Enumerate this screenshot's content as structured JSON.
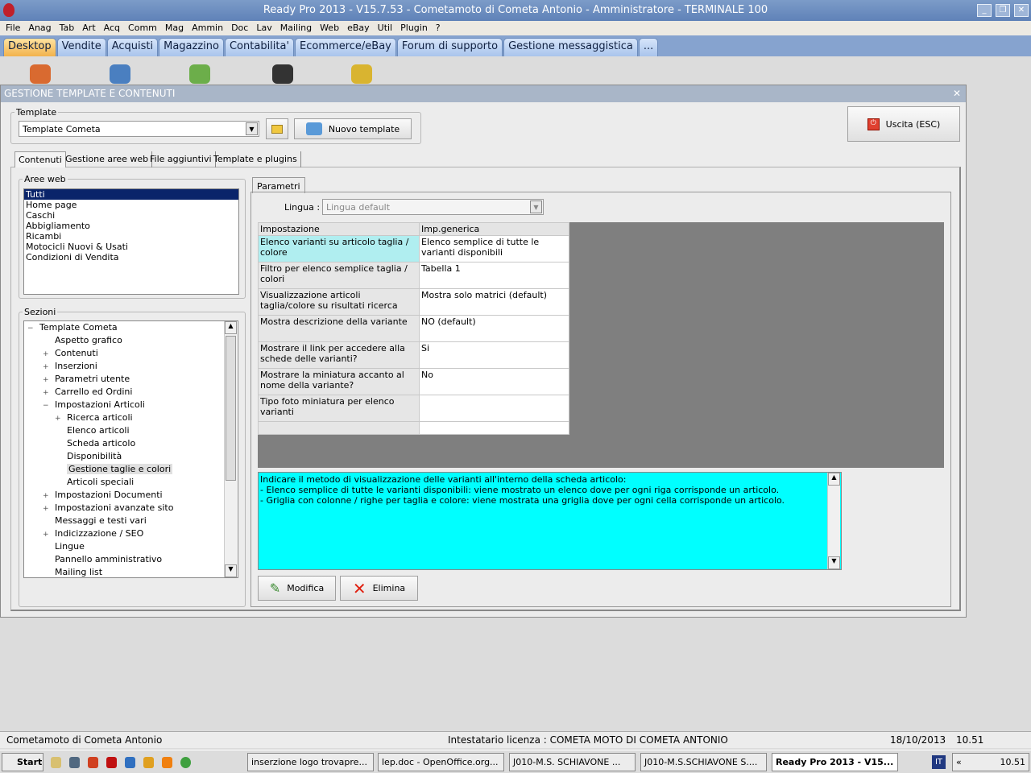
{
  "title": "Ready Pro 2013 - V15.7.53 - Cometamoto di Cometa Antonio - Amministratore - TERMINALE 100",
  "menu": [
    "File",
    "Anag",
    "Tab",
    "Art",
    "Acq",
    "Comm",
    "Mag",
    "Ammin",
    "Doc",
    "Lav",
    "Mailing",
    "Web",
    "eBay",
    "Util",
    "Plugin",
    "?"
  ],
  "main_tabs": [
    "Desktop",
    "Vendite",
    "Acquisti",
    "Magazzino",
    "Contabilita'",
    "Ecommerce/eBay",
    "Forum di supporto",
    "Gestione messaggistica",
    "..."
  ],
  "window": {
    "title": "GESTIONE TEMPLATE E CONTENUTI",
    "template_label": "Template",
    "template_value": "Template Cometa",
    "new_template": "Nuovo template",
    "exit": "Uscita (ESC)",
    "sub_tabs": [
      "Contenuti",
      "Gestione aree web",
      "File aggiuntivi",
      "Template e plugins"
    ],
    "aree_label": "Aree web",
    "aree": [
      "Tutti",
      "Home page",
      "Caschi",
      "Abbigliamento",
      "Ricambi",
      "Motocicli Nuovi & Usati",
      "Condizioni di Vendita"
    ],
    "sezioni_label": "Sezioni",
    "tree": [
      {
        "t": "Template Cometa",
        "l": 0,
        "s": "−"
      },
      {
        "t": "Aspetto grafico",
        "l": 1,
        "s": ""
      },
      {
        "t": "Contenuti",
        "l": 1,
        "s": "+"
      },
      {
        "t": "Inserzioni",
        "l": 1,
        "s": "+"
      },
      {
        "t": "Parametri utente",
        "l": 1,
        "s": "+"
      },
      {
        "t": "Carrello ed Ordini",
        "l": 1,
        "s": "+"
      },
      {
        "t": "Impostazioni Articoli",
        "l": 1,
        "s": "−"
      },
      {
        "t": "Ricerca articoli",
        "l": 2,
        "s": "+"
      },
      {
        "t": "Elenco articoli",
        "l": 2,
        "s": ""
      },
      {
        "t": "Scheda articolo",
        "l": 2,
        "s": ""
      },
      {
        "t": "Disponibilità",
        "l": 2,
        "s": ""
      },
      {
        "t": "Gestione taglie e colori",
        "l": 2,
        "s": "",
        "sel": true
      },
      {
        "t": "Articoli speciali",
        "l": 2,
        "s": ""
      },
      {
        "t": "Impostazioni Documenti",
        "l": 1,
        "s": "+"
      },
      {
        "t": "Impostazioni avanzate sito",
        "l": 1,
        "s": "+"
      },
      {
        "t": "Messaggi e testi vari",
        "l": 1,
        "s": ""
      },
      {
        "t": "Indicizzazione / SEO",
        "l": 1,
        "s": "+"
      },
      {
        "t": "Lingue",
        "l": 1,
        "s": ""
      },
      {
        "t": "Pannello amministrativo",
        "l": 1,
        "s": ""
      },
      {
        "t": "Mailing list",
        "l": 1,
        "s": ""
      }
    ],
    "param_tab": "Parametri",
    "lingua_label": "Lingua :",
    "lingua_value": "Lingua default",
    "grid_headers": [
      "Impostazione",
      "Imp.generica"
    ],
    "grid_rows": [
      [
        "Elenco varianti su articolo taglia / colore",
        "Elenco semplice di tutte le varianti disponibili"
      ],
      [
        "Filtro per elenco semplice taglia / colori",
        "Tabella 1"
      ],
      [
        "Visualizzazione articoli taglia/colore su risultati ricerca",
        "Mostra solo matrici (default)"
      ],
      [
        "Mostra descrizione della variante",
        "NO (default)"
      ],
      [
        "Mostrare il link per accedere alla schede delle varianti?",
        "Si"
      ],
      [
        "Mostrare la miniatura accanto al nome della variante?",
        "No"
      ],
      [
        "Tipo foto miniatura per elenco varianti",
        ""
      ],
      [
        "",
        ""
      ]
    ],
    "description": [
      "Indicare il metodo di visualizzazione delle varianti all'interno della scheda articolo:",
      "- Elenco semplice di tutte le varianti disponibili: viene mostrato un elenco dove per ogni riga corrisponde un articolo.",
      "- Griglia con colonne / righe per taglia e colore: viene mostrata una griglia dove per ogni cella corrisponde un articolo."
    ],
    "modifica": "Modifica",
    "elimina": "Elimina"
  },
  "status": {
    "company": "Cometamoto di Cometa Antonio",
    "license": "Intestatario licenza : COMETA MOTO DI COMETA ANTONIO",
    "date": "18/10/2013",
    "time": "10.51"
  },
  "taskbar": {
    "start": "Start",
    "tasks": [
      "inserzione logo trovapre...",
      "lep.doc - OpenOffice.org...",
      "J010-M.S. SCHIAVONE ...",
      "J010-M.S.SCHIAVONE S....",
      "Ready Pro 2013 - V15..."
    ],
    "lang": "IT",
    "clock": "10.51"
  }
}
